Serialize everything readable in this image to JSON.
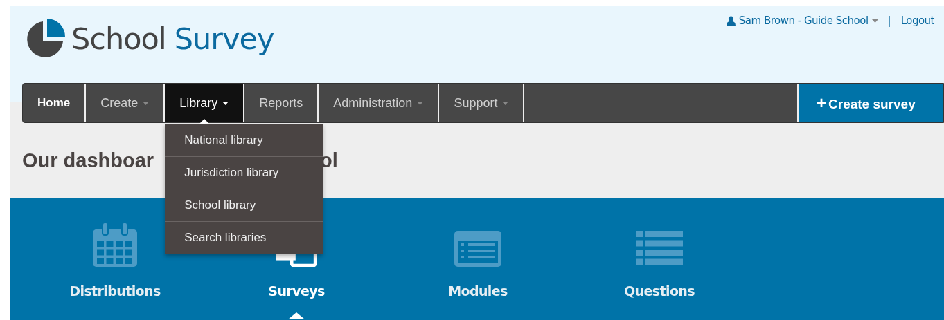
{
  "logo": {
    "word_1": "School",
    "word_2": "Survey"
  },
  "user_bar": {
    "user": "Sam Brown - Guide School",
    "separator": "|",
    "logout": "Logout"
  },
  "nav": {
    "items": [
      {
        "label": "Home",
        "selected": false,
        "has_menu": false,
        "bold": true
      },
      {
        "label": "Create",
        "selected": false,
        "has_menu": true,
        "bold": false
      },
      {
        "label": "Library",
        "selected": true,
        "has_menu": true,
        "bold": false
      },
      {
        "label": "Reports",
        "selected": false,
        "has_menu": false,
        "bold": false
      },
      {
        "label": "Administration",
        "selected": false,
        "has_menu": true,
        "bold": false
      },
      {
        "label": "Support",
        "selected": false,
        "has_menu": true,
        "bold": false
      }
    ],
    "action": {
      "icon": "+",
      "label": "Create survey"
    }
  },
  "dropdown": {
    "items": [
      "National library",
      "Jurisdiction library",
      "School library",
      "Search libraries"
    ]
  },
  "heading": {
    "start": "Our dashboar",
    "end": "ol"
  },
  "tiles": [
    {
      "kind": "calendar",
      "label": "Distributions",
      "selected": false
    },
    {
      "kind": "surveys",
      "label": "Surveys",
      "selected": true
    },
    {
      "kind": "modules",
      "label": "Modules",
      "selected": false
    },
    {
      "kind": "questions",
      "label": "Questions",
      "selected": false
    }
  ]
}
